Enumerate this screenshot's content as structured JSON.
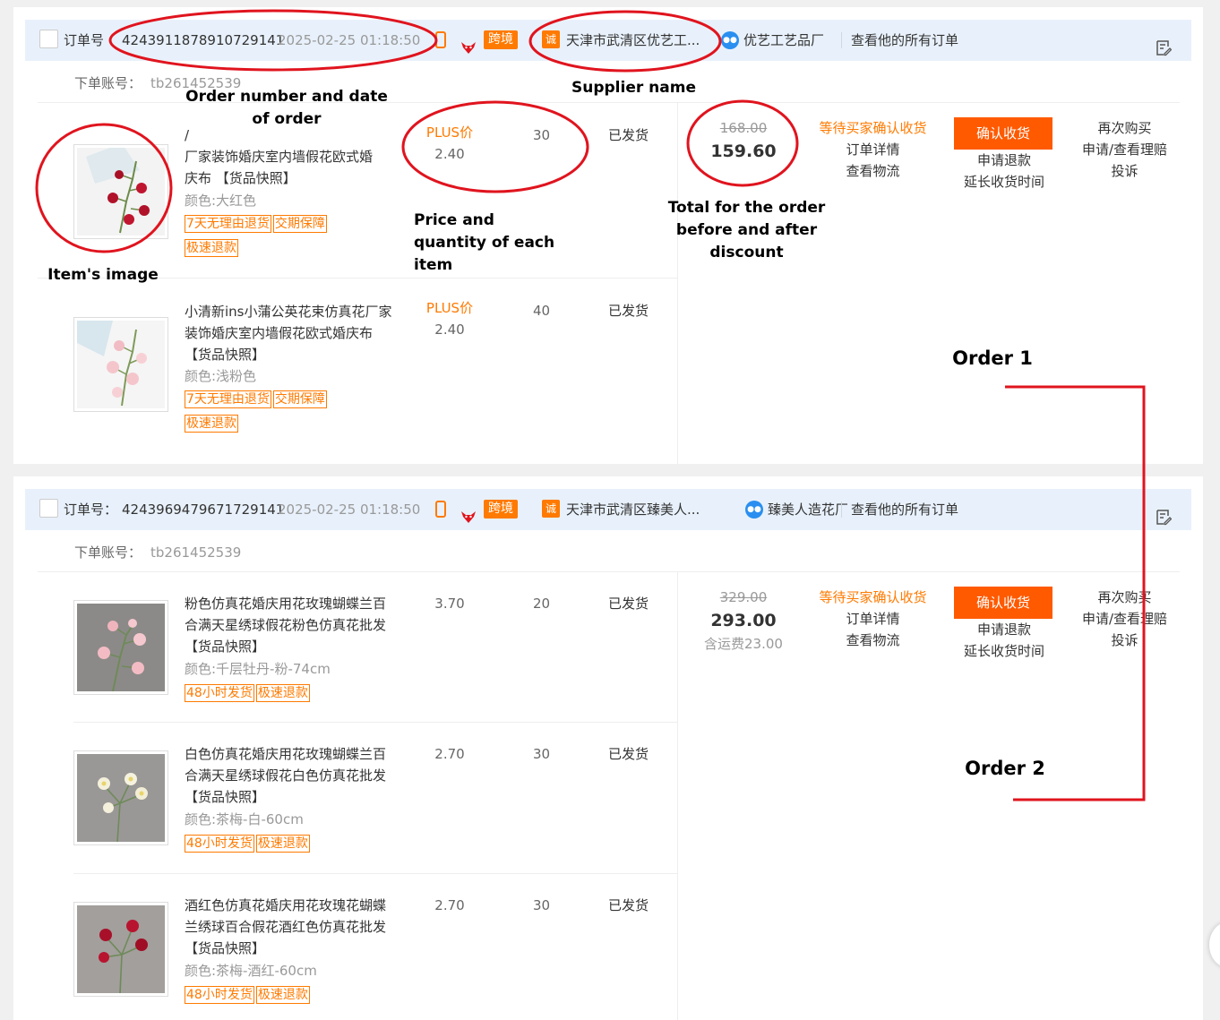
{
  "orders": [
    {
      "order_no_label": "订单号",
      "order_no": "4243911878910729141",
      "date": "2025-02-25 01:18:50",
      "crossborder": "跨境",
      "shop_icon": "诚",
      "shop": "天津市武清区优艺工...",
      "seller": "优艺工艺品厂",
      "all_orders": "查看他的所有订单",
      "account_label": "下单账号：",
      "account": "tb261452539",
      "orig_total": "168.00",
      "paid_total": "159.60",
      "status": "等待买家确认收货",
      "order_detail": "订单详情",
      "logistics": "查看物流",
      "confirm": "确认收货",
      "refund": "申请退款",
      "extend": "延长收货时间",
      "rebuy": "再次购买",
      "claim": "申请/查看理赔",
      "complain": "投诉",
      "items": [
        {
          "title": "小清新ins小蒲公英花束仿真花厂家装饰婚庆室内墙假花欧式婚庆布 【货品快照】",
          "title_visible": "/\n厂家装饰婚庆室内墙假花欧式婚\n庆布 【货品快照】",
          "spec": "颜色:大红色",
          "tags": [
            "7天无理由退货",
            "交期保障",
            "极速退款"
          ],
          "plus": "PLUS价",
          "price": "2.40",
          "qty": "30",
          "item_status": "已发货"
        },
        {
          "title": "小清新ins小蒲公英花束仿真花厂家装饰婚庆室内墙假花欧式婚庆布 【货品快照】",
          "spec": "颜色:浅粉色",
          "tags": [
            "7天无理由退货",
            "交期保障",
            "极速退款"
          ],
          "plus": "PLUS价",
          "price": "2.40",
          "qty": "40",
          "item_status": "已发货"
        }
      ]
    },
    {
      "order_no_label": "订单号：",
      "order_no": "4243969479671729141",
      "date": "2025-02-25 01:18:50",
      "crossborder": "跨境",
      "shop_icon": "诚",
      "shop": "天津市武清区臻美人...",
      "seller": "臻美人造花厂",
      "all_orders": "查看他的所有订单",
      "account_label": "下单账号：",
      "account": "tb261452539",
      "orig_total": "329.00",
      "paid_total": "293.00",
      "shipping": "含运费23.00",
      "status": "等待买家确认收货",
      "order_detail": "订单详情",
      "logistics": "查看物流",
      "confirm": "确认收货",
      "refund": "申请退款",
      "extend": "延长收货时间",
      "rebuy": "再次购买",
      "claim": "申请/查看理赔",
      "complain": "投诉",
      "items": [
        {
          "title": "粉色仿真花婚庆用花玫瑰蝴蝶兰百合满天星绣球假花粉色仿真花批发 【货品快照】",
          "spec": "颜色:千层牡丹-粉-74cm",
          "tags": [
            "48小时发货",
            "极速退款"
          ],
          "price": "3.70",
          "qty": "20",
          "item_status": "已发货"
        },
        {
          "title": "白色仿真花婚庆用花玫瑰蝴蝶兰百合满天星绣球假花白色仿真花批发 【货品快照】",
          "spec": "颜色:茶梅-白-60cm",
          "tags": [
            "48小时发货",
            "极速退款"
          ],
          "price": "2.70",
          "qty": "30",
          "item_status": "已发货"
        },
        {
          "title": "酒红色仿真花婚庆用花玫瑰花蝴蝶兰绣球百合假花酒红色仿真花批发 【货品快照】",
          "spec": "颜色:茶梅-酒红-60cm",
          "tags": [
            "48小时发货",
            "极速退款"
          ],
          "price": "2.70",
          "qty": "30",
          "item_status": "已发货"
        }
      ]
    }
  ],
  "annotations": {
    "order_number_date": "Order number and date of order",
    "supplier_name": "Supplier name",
    "item_image": "Item's image",
    "price_qty": "Price and quantity of each item",
    "total": "Total for the order before and after discount",
    "order1": "Order 1",
    "order2": "Order 2"
  },
  "colors": {
    "accent": "#ff7a00",
    "button": "#ff5a00",
    "header_bg": "#e8f1fb",
    "annotation": "#e0141e"
  }
}
